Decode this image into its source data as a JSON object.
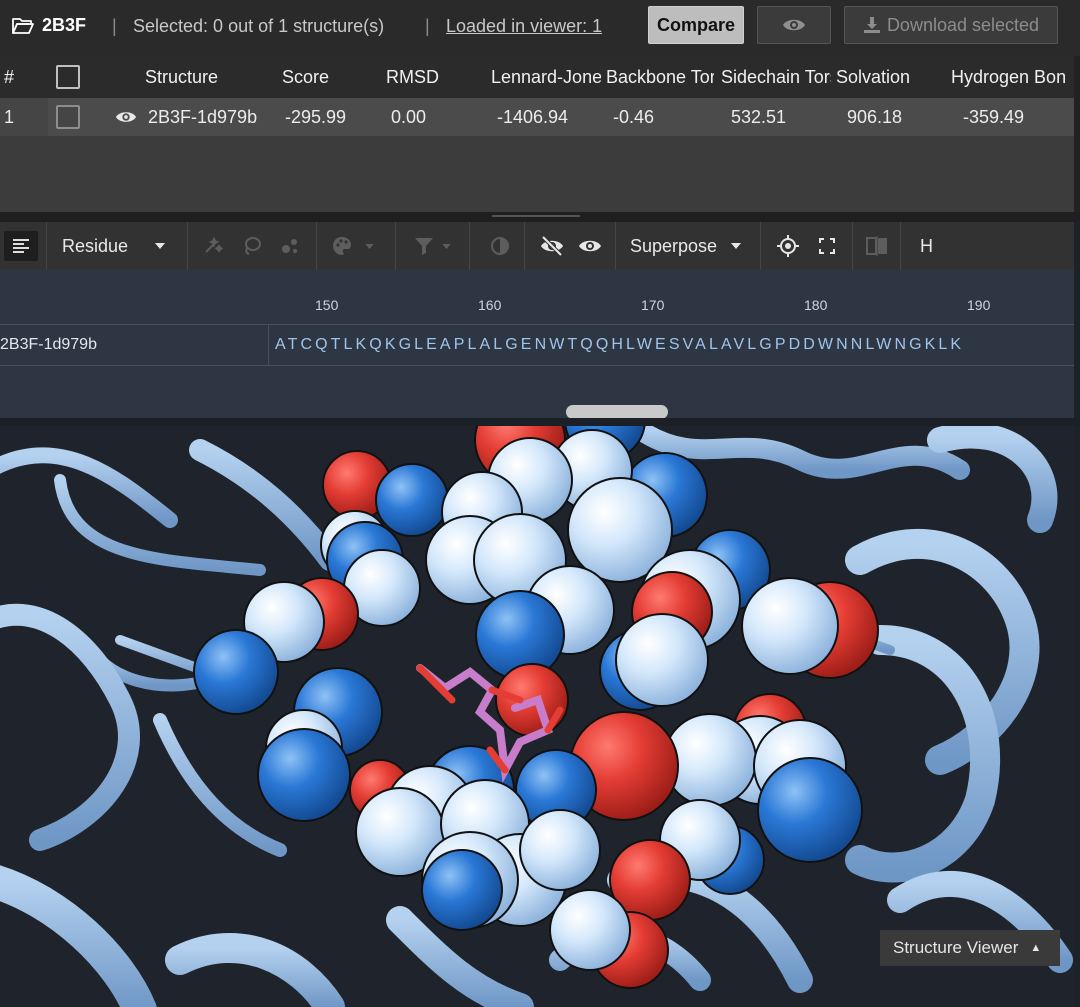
{
  "topbar": {
    "project": "2B3F",
    "selected_text": "Selected: 0 out of 1 structure(s)",
    "loaded_text": "Loaded in viewer: 1",
    "compare_label": "Compare",
    "download_label": "Download selected"
  },
  "table": {
    "columns": [
      "#",
      "Structure",
      "Score",
      "RMSD",
      "Lennard-Jones",
      "Backbone Torsion",
      "Sidechain Torsion",
      "Solvation",
      "Hydrogen Bond"
    ],
    "rows": [
      {
        "index": "1",
        "structure": "2B3F-1d979b",
        "score": "-295.99",
        "rmsd": "0.00",
        "lj": "-1406.94",
        "backbone": "-0.46",
        "sidechain": "532.51",
        "solvation": "906.18",
        "hbond": "-359.49"
      }
    ]
  },
  "toolbar": {
    "residue_label": "Residue",
    "superpose_label": "Superpose",
    "h_label": "H"
  },
  "sequence": {
    "ruler": [
      "150",
      "160",
      "170",
      "180",
      "190"
    ],
    "name": "2B3F-1d979b",
    "residues": "ATCQTLKQKGLEAPLALGENWTQQHLWESVALAVLGPDDWNNLWNGKLK"
  },
  "viewer": {
    "label": "Structure Viewer",
    "colors": {
      "oxygen": "#e43d34",
      "nitrogen": "#2a78d6",
      "carbon": "#d4e8fb",
      "ribbon": "#93b8e1",
      "ligand": "#c77dc9"
    }
  }
}
